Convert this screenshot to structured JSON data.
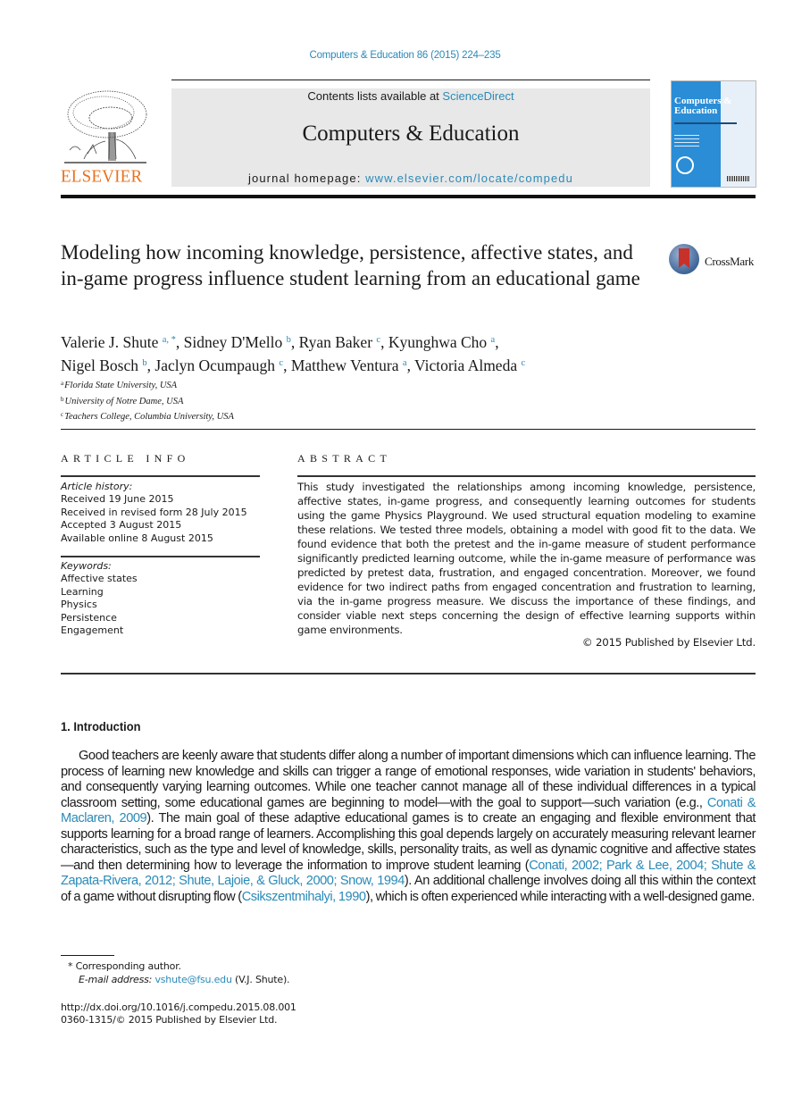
{
  "header": {
    "citation": "Computers & Education 86 (2015) 224–235",
    "contents_prefix": "Contents lists available at ",
    "contents_link": "ScienceDirect",
    "journal_title": "Computers & Education",
    "homepage_prefix": "journal homepage: ",
    "homepage_link": "www.elsevier.com/locate/compedu",
    "publisher_logo_text": "ELSEVIER",
    "cover_title": "Computers & Education",
    "colors": {
      "link": "#2a8ab8",
      "elsevier_orange": "#e9711c",
      "cover_blue": "#2a8dd6",
      "band_gray": "#e8e8e8"
    }
  },
  "article": {
    "title": "Modeling how incoming knowledge, persistence, affective states, and in-game progress influence student learning from an educational game",
    "crossmark_label": "CrossMark",
    "authors": [
      {
        "name": "Valerie J. Shute",
        "sup": "a, *",
        "sep": ", "
      },
      {
        "name": "Sidney D'Mello",
        "sup": "b",
        "sep": ", "
      },
      {
        "name": "Ryan Baker",
        "sup": "c",
        "sep": ", "
      },
      {
        "name": "Kyunghwa Cho",
        "sup": "a",
        "sep": ","
      },
      {
        "name": "Nigel Bosch",
        "sup": "b",
        "sep": ", "
      },
      {
        "name": "Jaclyn Ocumpaugh",
        "sup": "c",
        "sep": ", "
      },
      {
        "name": "Matthew Ventura",
        "sup": "a",
        "sep": ", "
      },
      {
        "name": "Victoria Almeda",
        "sup": "c",
        "sep": ""
      }
    ],
    "affiliations": [
      {
        "sup": "a",
        "text": "Florida State University, USA"
      },
      {
        "sup": "b",
        "text": "University of Notre Dame, USA"
      },
      {
        "sup": "c",
        "text": "Teachers College, Columbia University, USA"
      }
    ]
  },
  "article_info": {
    "heading": "ARTICLE INFO",
    "history_label": "Article history:",
    "history": [
      "Received 19 June 2015",
      "Received in revised form 28 July 2015",
      "Accepted 3 August 2015",
      "Available online 8 August 2015"
    ],
    "keywords_label": "Keywords:",
    "keywords": [
      "Affective states",
      "Learning",
      "Physics",
      "Persistence",
      "Engagement"
    ]
  },
  "abstract": {
    "heading": "ABSTRACT",
    "text": "This study investigated the relationships among incoming knowledge, persistence, affective states, in-game progress, and consequently learning outcomes for students using the game Physics Playground. We used structural equation modeling to examine these relations. We tested three models, obtaining a model with good fit to the data. We found evidence that both the pretest and the in-game measure of student performance significantly predicted learning outcome, while the in-game measure of performance was predicted by pretest data, frustration, and engaged concentration. Moreover, we found evidence for two indirect paths from engaged concentration and frustration to learning, via the in-game progress measure. We discuss the importance of these findings, and consider viable next steps concerning the design of effective learning supports within game environments.",
    "copyright": "© 2015 Published by Elsevier Ltd."
  },
  "introduction": {
    "heading": "1.  Introduction",
    "segments": [
      {
        "t": "Good teachers are keenly aware that students differ along a number of important dimensions which can influence learning. The process of learning new knowledge and skills can trigger a range of emotional responses, wide variation in students' behaviors, and consequently varying learning outcomes. While one teacher cannot manage all of these individual differences in a typical classroom setting, some educational games are beginning to model—with the goal to support—such variation (e.g., "
      },
      {
        "t": "Conati & Maclaren, 2009",
        "link": true
      },
      {
        "t": "). The main goal of these adaptive educational games is to create an engaging and flexible environment that supports learning for a broad range of learners. Accomplishing this goal depends largely on accurately measuring relevant learner characteristics, such as the type and level of knowledge, skills, personality traits, as well as dynamic cognitive and affective states —and then determining how to leverage the information to improve student learning ("
      },
      {
        "t": "Conati, 2002; Park & Lee, 2004; Shute & Zapata-Rivera, 2012; Shute, Lajoie, & Gluck, 2000; Snow, 1994",
        "link": true
      },
      {
        "t": "). An additional challenge involves doing all this within the context of a game without disrupting flow ("
      },
      {
        "t": "Csikszentmihalyi, 1990",
        "link": true
      },
      {
        "t": "), which is often experienced while interacting with a well-designed game."
      }
    ]
  },
  "footnotes": {
    "corresponding": "*  Corresponding author.",
    "email_label": "E-mail address: ",
    "email": "vshute@fsu.edu",
    "email_suffix": " (V.J. Shute).",
    "doi": "http://dx.doi.org/10.1016/j.compedu.2015.08.001",
    "issn_line": "0360-1315/© 2015 Published by Elsevier Ltd."
  }
}
